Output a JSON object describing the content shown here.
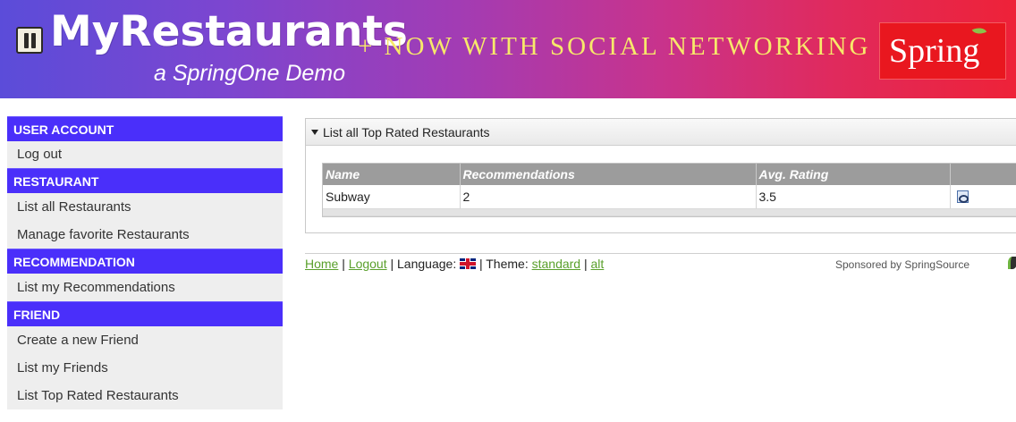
{
  "header": {
    "brand": "MyRestaurants",
    "subtitle": "a SpringOne Demo",
    "tagline": "+ NOW WITH SOCIAL NETWORKING",
    "spring_logo": "Spring"
  },
  "sidebar": {
    "sections": [
      {
        "title": "USER ACCOUNT",
        "items": [
          "Log out"
        ]
      },
      {
        "title": "RESTAURANT",
        "items": [
          "List all Restaurants",
          "Manage favorite Restaurants"
        ]
      },
      {
        "title": "RECOMMENDATION",
        "items": [
          "List my Recommendations"
        ]
      },
      {
        "title": "FRIEND",
        "items": [
          "Create a new Friend",
          "List my Friends",
          "List Top Rated Restaurants"
        ]
      }
    ]
  },
  "panel": {
    "title": "List all Top Rated Restaurants",
    "columns": [
      "Name",
      "Recommendations",
      "Avg. Rating",
      ""
    ],
    "rows": [
      {
        "name": "Subway",
        "recommendations": "2",
        "avg_rating": "3.5",
        "action_icon": "show-icon"
      }
    ]
  },
  "footer": {
    "home": "Home",
    "sep1": " | ",
    "logout": "Logout",
    "language_label": " | Language: ",
    "language_icon": "uk-flag-icon",
    "theme_label": " | Theme: ",
    "theme_standard": "standard",
    "sep2": " | ",
    "theme_alt": "alt",
    "sponsored": "Sponsored by SpringSource"
  },
  "colors": {
    "section_header": "#4a2ffa",
    "link": "#5aa02c",
    "table_header": "#9c9c9c",
    "tagline": "#f7e96a"
  }
}
